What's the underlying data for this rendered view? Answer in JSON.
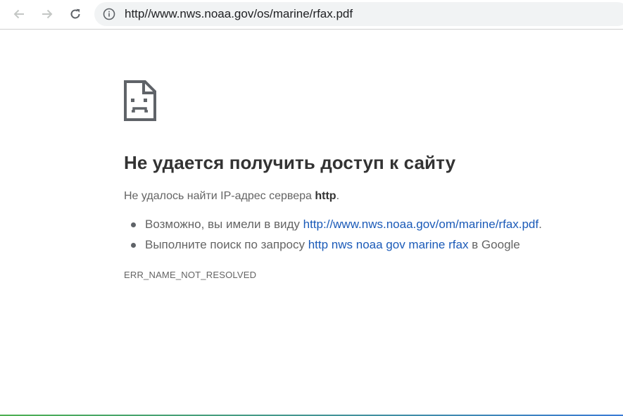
{
  "browser": {
    "address_bar": {
      "url": "http//www.nws.noaa.gov/os/marine/rfax.pdf"
    },
    "icons": {
      "back": "arrow-left",
      "forward": "arrow-right",
      "reload": "reload",
      "info": "info-circle"
    }
  },
  "error_page": {
    "title": "Не удается получить доступ к сайту",
    "summary_prefix": "Не удалось найти IP-адрес сервера ",
    "summary_host": "http",
    "summary_suffix": ".",
    "suggestions": [
      {
        "prefix": "Возможно, вы имели в виду ",
        "link": "http://www.nws.noaa.gov/om/marine/rfax.pdf",
        "suffix": "."
      },
      {
        "prefix": "Выполните поиск по запросу ",
        "link": "http nws noaa gov marine rfax",
        "suffix": " в Google"
      }
    ],
    "error_code": "ERR_NAME_NOT_RESOLVED"
  },
  "colors": {
    "link": "#1a5ab8",
    "title": "#333333",
    "body_text": "#646464"
  }
}
